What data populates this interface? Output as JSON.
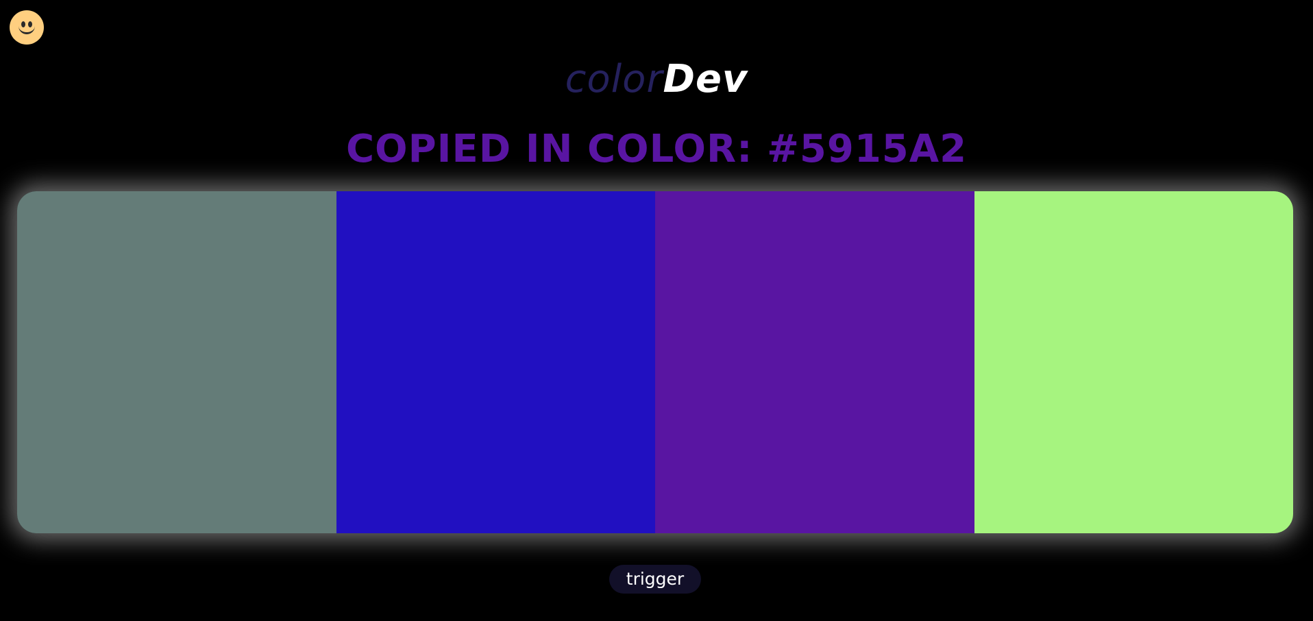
{
  "emoji_button": {
    "icon": "smiley-face-icon",
    "color": "#ffcf80"
  },
  "logo": {
    "part1": "color",
    "part2": "Dev",
    "part1_color": "#25215d",
    "part2_color": "#ffffff"
  },
  "headline": {
    "text": "COPIED IN COLOR: #5915A2",
    "color": "#5915a2"
  },
  "palette": {
    "swatches": [
      {
        "color": "#647c78"
      },
      {
        "color": "#2110c1"
      },
      {
        "color": "#5915a2"
      },
      {
        "color": "#a6f47f"
      }
    ]
  },
  "trigger_button": {
    "label": "trigger"
  }
}
